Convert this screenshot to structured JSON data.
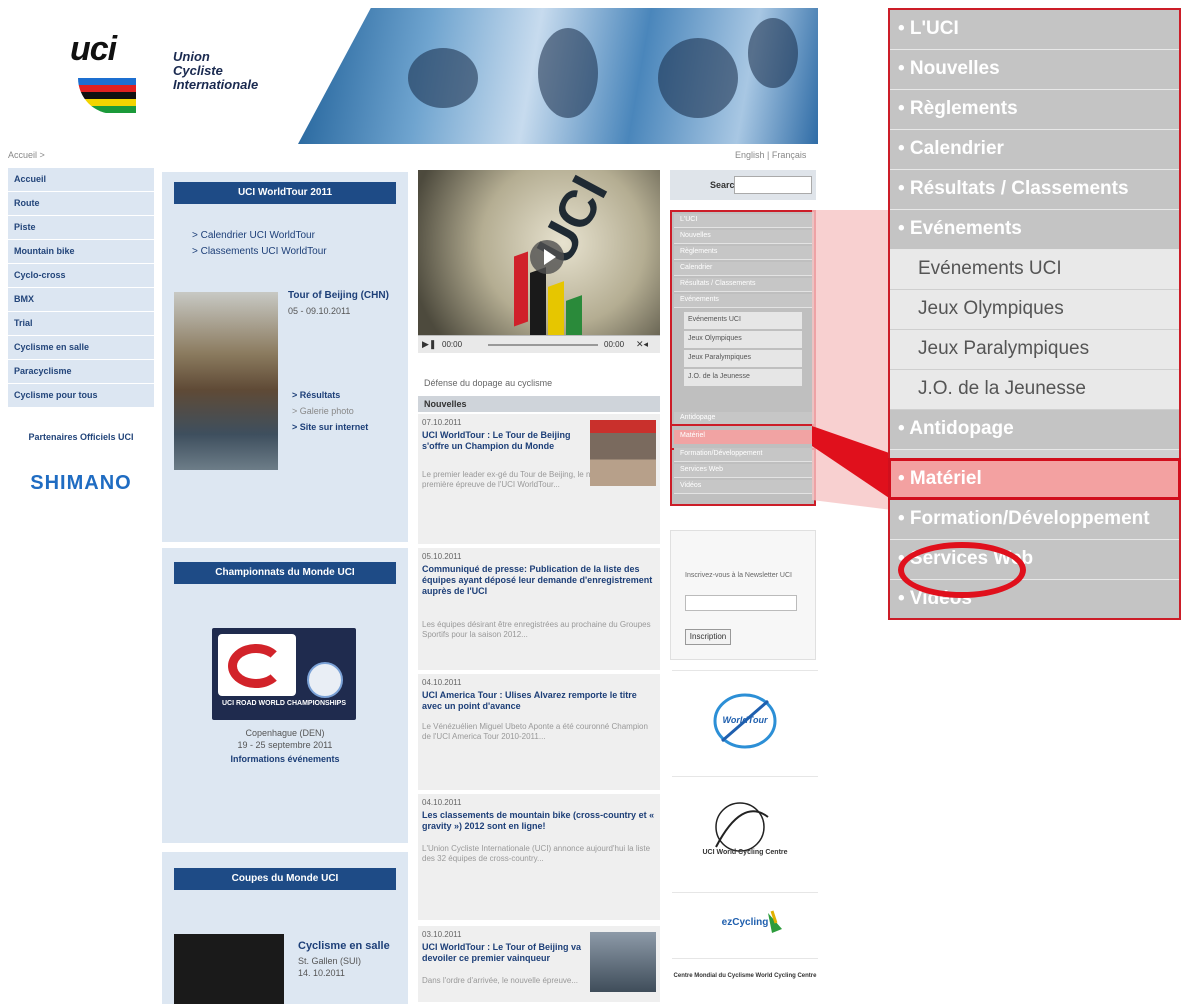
{
  "header": {
    "logo_text": "uci",
    "org_name": "Union\nCycliste\nInternationale",
    "stripe_colors": [
      "#1d6fd0",
      "#e02020",
      "#111111",
      "#f2d400",
      "#1b9a3a"
    ]
  },
  "breadcrumb": "Accueil >",
  "lang": "English | Français",
  "left_nav": {
    "items": [
      "Accueil",
      "Route",
      "Piste",
      "Mountain bike",
      "Cyclo-cross",
      "BMX",
      "Trial",
      "Cyclisme en salle",
      "Paracyclisme",
      "Cyclisme pour tous"
    ],
    "partners_label": "Partenaires Officiels UCI",
    "sponsor": "SHIMANO"
  },
  "worldtour": {
    "title": "UCI WorldTour 2011",
    "links": [
      "> Calendrier UCI WorldTour",
      "> Classements UCI WorldTour"
    ],
    "race_title": "Tour of Beijing (CHN)",
    "race_dates": "05 - 09.10.2011",
    "results": "> Résultats",
    "gallery": "> Galerie photo",
    "website": "> Site sur internet"
  },
  "worldchamps": {
    "title": "Championnats du Monde UCI",
    "logo_caption": "UCI ROAD WORLD CHAMPIONSHIPS",
    "city": "Copenhague (DEN)",
    "dates": "19 - 25 septembre 2011",
    "info": "Informations événements"
  },
  "cups": {
    "title": "Coupes du Monde UCI",
    "event": "Cyclisme en salle",
    "location": "St. Gallen (SUI)",
    "date": "14. 10.2011"
  },
  "video": {
    "overlay_text": "UCI",
    "time_start": "00:00",
    "time_end": "00:00",
    "caption": "Défense du dopage au cyclisme"
  },
  "news": {
    "header": "Nouvelles",
    "items": [
      {
        "date": "07.10.2011",
        "title": "UCI WorldTour : Le Tour de Beijing s'offre un Champion du Monde",
        "body": "Le premier leader ex-gé du Tour de Beijing, le nouveau et première épreuve de l'UCI WorldTour..."
      },
      {
        "date": "05.10.2011",
        "title": "Communiqué de presse: Publication de la liste des équipes ayant déposé leur demande d'enregistrement auprès de l'UCI",
        "body": "Les équipes désirant être enregistrées au prochaine du Groupes Sportifs pour la saison 2012..."
      },
      {
        "date": "04.10.2011",
        "title": "UCI America Tour : Ulises Alvarez remporte le titre avec un point d'avance",
        "body": "Le Vénézuélien Miguel Ubeto Aponte a été couronné Champion de l'UCI America Tour 2010-2011..."
      },
      {
        "date": "04.10.2011",
        "title": "Les classements de mountain bike (cross-country et « gravity ») 2012 sont en ligne!",
        "body": "L'Union Cycliste Internationale (UCI) annonce aujourd'hui la liste des 32 équipes de cross-country..."
      },
      {
        "date": "03.10.2011",
        "title": "UCI WorldTour : Le Tour of Beijing va devoiler ce premier vainqueur",
        "body": "Dans l'ordre d'arrivée, le nouvelle épreuve..."
      }
    ]
  },
  "search": {
    "label": "Search",
    "placeholder": ""
  },
  "mini_menu": {
    "items": [
      "L'UCI",
      "Nouvelles",
      "Règlements",
      "Calendrier",
      "Résultats / Classements",
      "Evénements"
    ],
    "subitems": [
      "Evénements UCI",
      "Jeux Olympiques",
      "Jeux Paralympiques",
      "J.O. de la Jeunesse"
    ],
    "after": [
      "Antidopage",
      "Matériel",
      "Formation/Développement",
      "Services Web",
      "Vidéos"
    ]
  },
  "newsletter": {
    "text": "Inscrivez-vous à la Newsletter UCI",
    "button": "Inscription"
  },
  "partners": [
    "WorldTour",
    "UCI World Cycling Centre",
    "ezCycling",
    "Centre Mondial du Cyclisme World Cycling Centre"
  ],
  "big_menu": {
    "items": [
      "• L'UCI",
      "• Nouvelles",
      "• Règlements",
      "• Calendrier",
      "• Résultats / Classements",
      "• Evénements"
    ],
    "subitems": [
      "Evénements UCI",
      "Jeux Olympiques",
      "Jeux Paralympiques",
      "J.O. de la Jeunesse"
    ],
    "after": [
      "• Antidopage",
      "• Matériel",
      "• Formation/Développement",
      "• Services Web",
      "• Vidéos"
    ],
    "active_item": "• Matériel"
  },
  "colors": {
    "accent_red": "#cc1d28",
    "nav_blue": "#1e4b86",
    "menu_grey": "#c4c4c4",
    "active_pink": "#f3a1a1"
  }
}
